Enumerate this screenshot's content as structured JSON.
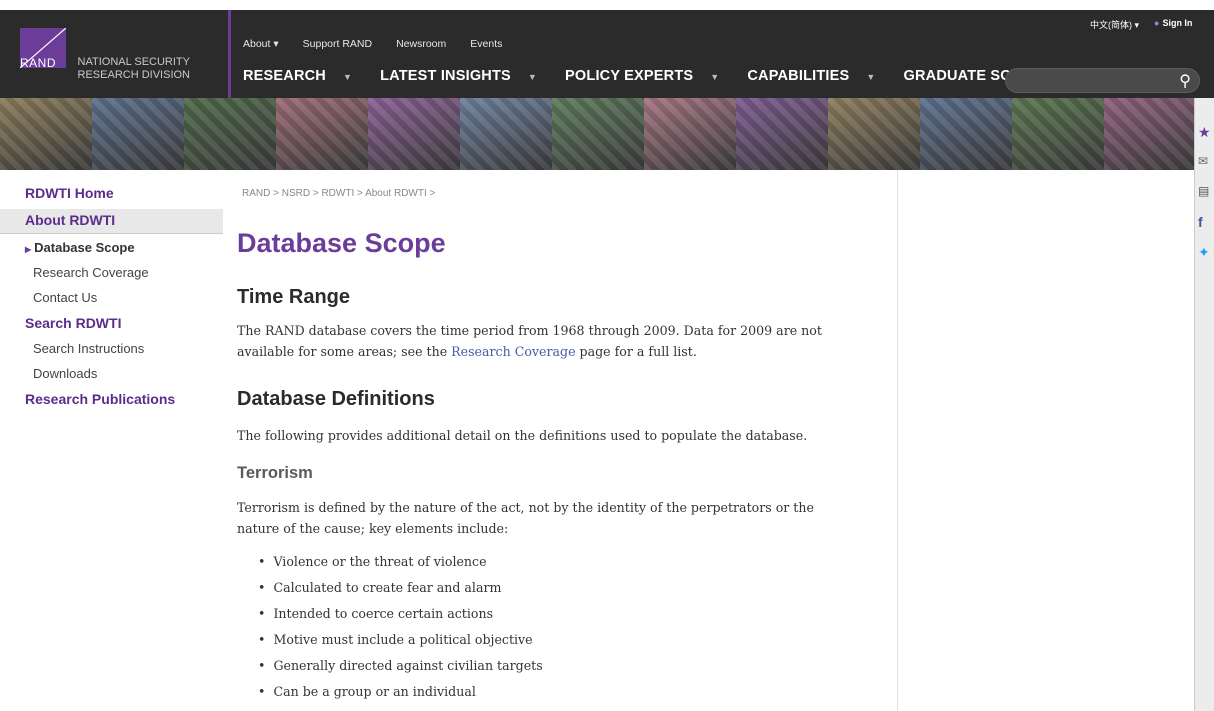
{
  "header": {
    "logo": {
      "rand": "RAND",
      "division_line1": "NATIONAL SECURITY",
      "division_line2": "RESEARCH DIVISION"
    },
    "top_links": [
      "About ▾",
      "Support RAND",
      "Newsroom",
      "Events"
    ],
    "main_nav": [
      "RESEARCH",
      "LATEST INSIGHTS",
      "POLICY EXPERTS",
      "CAPABILITIES",
      "GRADUATE SCHOOL"
    ],
    "language": "中文(简体) ▾",
    "sign_in": "Sign In",
    "search_placeholder": ""
  },
  "banner": {
    "tile_colors": [
      "#8a7b5a",
      "#5b6f8c",
      "#4f6a4a",
      "#9b6a74",
      "#8a5f94",
      "#6c7f9c",
      "#5d7a5b",
      "#a57482",
      "#7b5a90",
      "#8d7c5c",
      "#5c6f8e",
      "#59764e",
      "#8e5f7c"
    ]
  },
  "sidebar": {
    "home": "RDWTI Home",
    "about": "About RDWTI",
    "about_items": [
      "Database Scope",
      "Research Coverage",
      "Contact Us"
    ],
    "search": "Search RDWTI",
    "search_items": [
      "Search Instructions",
      "Downloads"
    ],
    "publications": "Research Publications"
  },
  "breadcrumb": "RAND > NSRD > RDWTI > About RDWTI >",
  "content": {
    "title": "Database Scope",
    "time_range_heading": "Time Range",
    "time_range_text_1": "The RAND database covers the time period from 1968 through 2009. Data for 2009 are not available for some areas; see the ",
    "time_range_link": "Research Coverage",
    "time_range_text_2": " page for a full list.",
    "definitions_heading": "Database Definitions",
    "definitions_text": "The following provides additional detail on the definitions used to populate the database.",
    "terrorism_heading": "Terrorism",
    "terrorism_text": "Terrorism is defined by the nature of the act, not by the identity of the perpetrators or the nature of the cause; key elements include:",
    "terrorism_bullets": [
      "Violence or the threat of violence",
      "Calculated to create fear and alarm",
      "Intended to coerce certain actions",
      "Motive must include a political objective",
      "Generally directed against civilian targets",
      "Can be a group or an individual"
    ]
  },
  "share_icons": [
    "star-icon",
    "mail-icon",
    "print-icon",
    "facebook-icon",
    "twitter-icon"
  ],
  "colors": {
    "brand_purple": "#6b3d99",
    "header_bg": "#2b2b2b",
    "link": "#4a5aa8"
  }
}
